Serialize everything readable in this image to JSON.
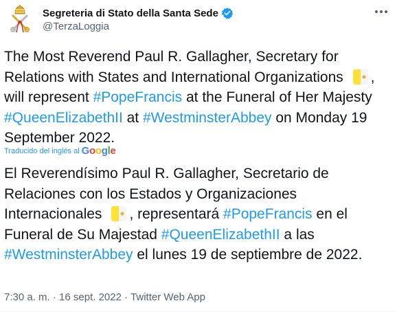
{
  "tweet": {
    "author_name": "Segreteria di Stato della Santa Sede",
    "handle": "@TerzaLoggia",
    "text_en": {
      "t1": "The Most Reverend Paul R. Gallagher, Secretary for Relations with States and International Organizations",
      "t2": ", will represent ",
      "h1": "#PopeFrancis",
      "t3": " at the Funeral of Her Majesty ",
      "h2": "#QueenElizabethII",
      "t4": " at ",
      "h3": "#WestminsterAbbey",
      "t5": " on Monday 19 September 2022."
    },
    "translated_label": "Traducido del inglés al",
    "google": {
      "G": "G",
      "o1": "o",
      "o2": "o",
      "g": "g",
      "l": "l",
      "e": "e"
    },
    "text_es": {
      "t1": "El Reverendísimo Paul R. Gallagher, Secretario de Relaciones con los Estados y Organizaciones Internacionales",
      "t2": ", representará ",
      "h1": "#PopeFrancis",
      "t3": " en el Funeral de Su Majestad ",
      "h2": "#QueenElizabethII",
      "t4": " a las ",
      "h3": "#WestminsterAbbey",
      "t5": " el lunes 19 de septiembre de 2022."
    },
    "time": "7:30 a. m.",
    "separator1": " · ",
    "date": "16 sept. 2022",
    "separator2": " · ",
    "source": "Twitter Web App"
  },
  "colors": {
    "link": "#1d9bf0",
    "text": "#0f1419",
    "muted": "#536471",
    "flag_yellow": "#ffe135",
    "flag_white": "#ffffff"
  },
  "icons": {
    "avatar": "holy-see-coat-of-arms",
    "verified": "verified-badge",
    "more": "more-dots",
    "flag": "vatican-flag"
  }
}
